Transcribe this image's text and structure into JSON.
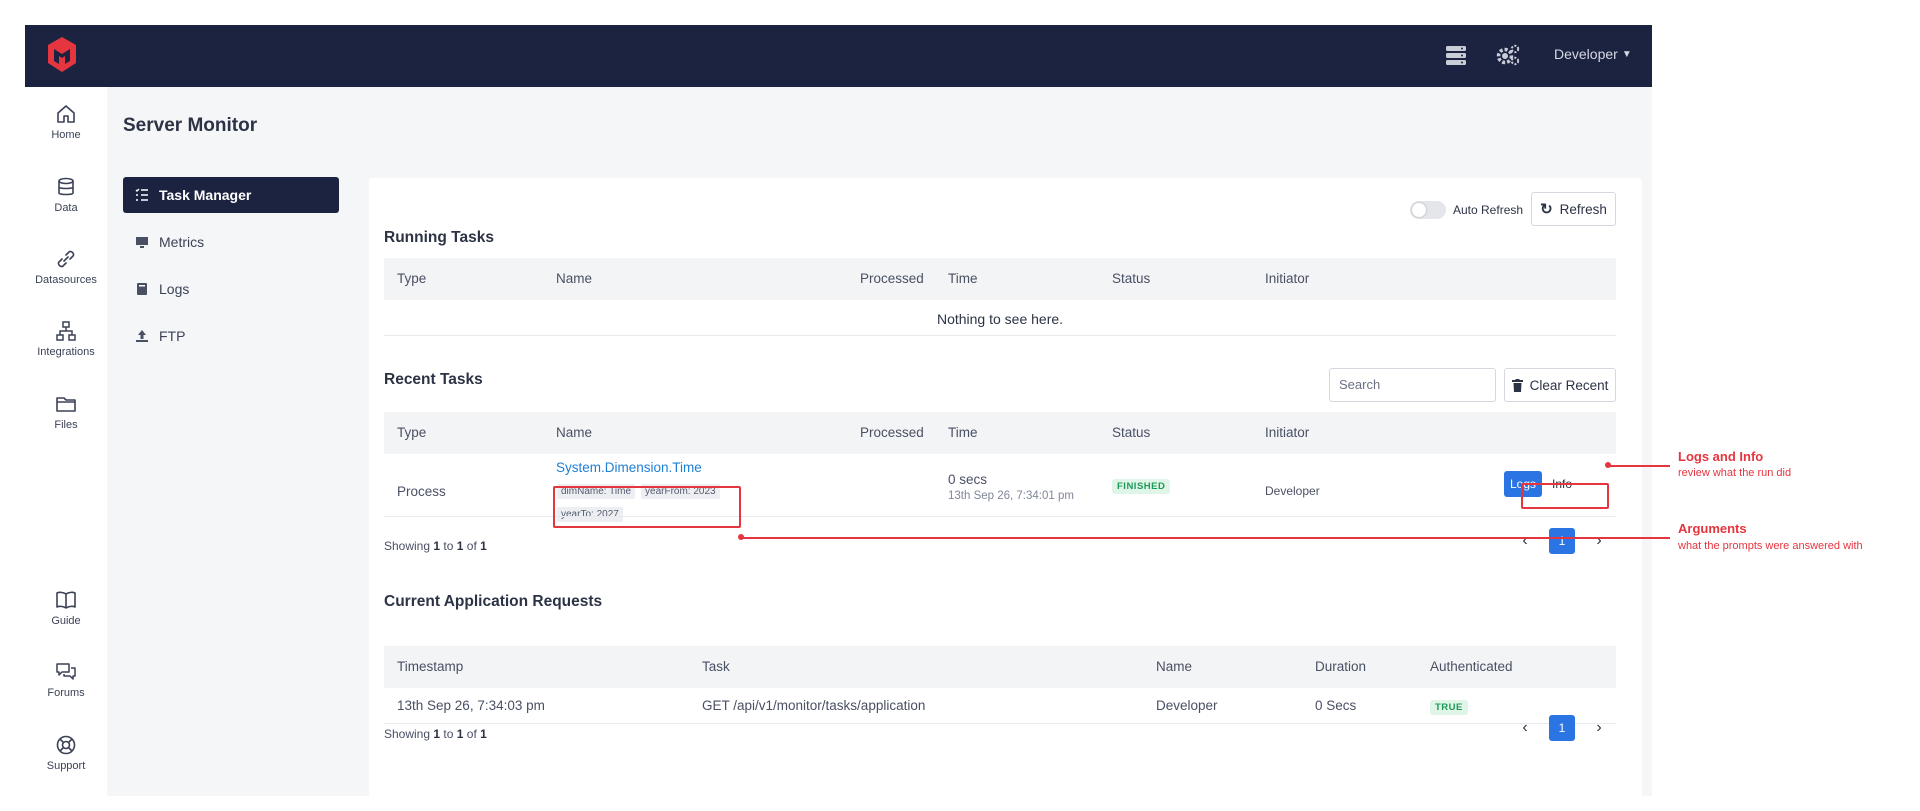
{
  "header": {
    "user": "Developer"
  },
  "nav": {
    "home": "Home",
    "data": "Data",
    "datasources": "Datasources",
    "integrations": "Integrations",
    "files": "Files",
    "guide": "Guide",
    "forums": "Forums",
    "support": "Support"
  },
  "page": {
    "title": "Server Monitor"
  },
  "submenu": {
    "task_manager": "Task Manager",
    "metrics": "Metrics",
    "logs": "Logs",
    "ftp": "FTP"
  },
  "controls": {
    "auto_refresh": "Auto Refresh",
    "refresh": "Refresh",
    "search_placeholder": "Search",
    "clear_recent": "Clear Recent"
  },
  "running": {
    "title": "Running Tasks",
    "columns": [
      "Type",
      "Name",
      "Processed",
      "Time",
      "Status",
      "Initiator"
    ],
    "empty": "Nothing to see here."
  },
  "recent": {
    "title": "Recent Tasks",
    "columns": [
      "Type",
      "Name",
      "Processed",
      "Time",
      "Status",
      "Initiator"
    ],
    "rows": [
      {
        "type": "Process",
        "name": "System.Dimension.Time",
        "args": [
          "dimName: Time",
          "yearFrom: 2023",
          "yearTo: 2027"
        ],
        "time": "0 secs",
        "timestamp": "13th Sep 26, 7:34:01 pm",
        "status": "FINISHED",
        "initiator": "Developer",
        "logs_label": "Logs",
        "info_label": "Info"
      }
    ],
    "showing": {
      "prefix": "Showing",
      "from": "1",
      "to_word": "to",
      "to": "1",
      "of_word": "of",
      "total": "1"
    },
    "page": "1"
  },
  "requests": {
    "title": "Current Application Requests",
    "columns": [
      "Timestamp",
      "Task",
      "Name",
      "Duration",
      "Authenticated"
    ],
    "rows": [
      {
        "timestamp": "13th Sep 26, 7:34:03 pm",
        "task": "GET /api/v1/monitor/tasks/application",
        "name": "Developer",
        "duration": "0 Secs",
        "authenticated": "TRUE"
      }
    ],
    "showing": {
      "prefix": "Showing",
      "from": "1",
      "to_word": "to",
      "to": "1",
      "of_word": "of",
      "total": "1"
    },
    "page": "1"
  },
  "annotations": {
    "logs_info": {
      "title": "Logs and Info",
      "subtitle": "review what the run did"
    },
    "arguments": {
      "title": "Arguments",
      "subtitle": "what the prompts were answered with"
    }
  },
  "colors": {
    "topbar": "#1c2340",
    "accent": "#2a74e4",
    "annotation": "#e5353f",
    "success": "#1e9a57"
  }
}
